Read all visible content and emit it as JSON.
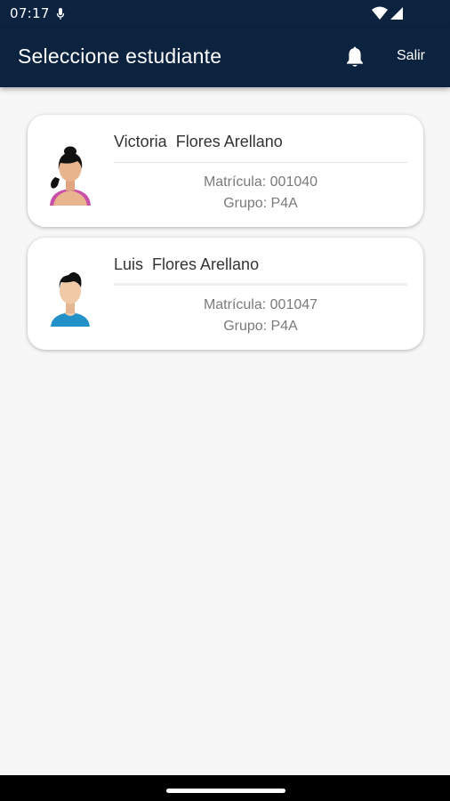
{
  "status_bar": {
    "time": "07:17"
  },
  "app_bar": {
    "title": "Seleccione estudiante",
    "logout_label": "Salir",
    "icons": [
      "bell-icon"
    ]
  },
  "students": [
    {
      "name": "Victoria  Flores Arellano",
      "matricula": "Matrícula: 001040",
      "grupo": "Grupo: P4A",
      "avatar": "girl-avatar-icon"
    },
    {
      "name": "Luis  Flores Arellano",
      "matricula": "Matrícula: 001047",
      "grupo": "Grupo: P4A",
      "avatar": "boy-avatar-icon"
    }
  ],
  "colors": {
    "app_bar": "#0c2340",
    "background": "#f7f7f7",
    "card": "#ffffff"
  }
}
